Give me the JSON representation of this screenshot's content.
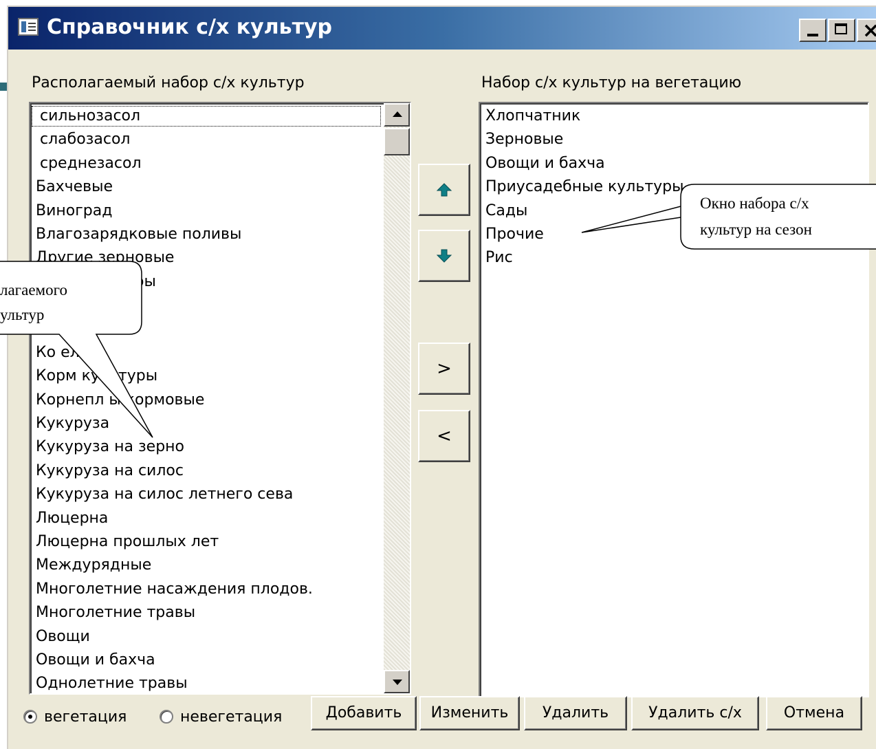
{
  "window": {
    "title": "Справочник с/х культур",
    "close_glyph": "×"
  },
  "left_panel": {
    "label": "Располагаемый набор с/х культур",
    "items": [
      {
        "label": "сильнозасол"
      },
      {
        "label": "слабозасол"
      },
      {
        "label": "среднезасол"
      },
      {
        "label": "Бахчевые"
      },
      {
        "label": "Виноград"
      },
      {
        "label": "Влагозарядковые поливы"
      },
      {
        "label": "Другие зерновые"
      },
      {
        "label": "овые культуры"
      },
      {
        "label": ""
      },
      {
        "label": ""
      },
      {
        "label": "Ко      ель"
      },
      {
        "label": "Корм      культуры"
      },
      {
        "label": "Корнепл     ы кормовые"
      },
      {
        "label": "Кукуруза"
      },
      {
        "label": "Кукуруза на зерно"
      },
      {
        "label": "Кукуруза на силос"
      },
      {
        "label": "Кукуруза на силос летнего сева"
      },
      {
        "label": "Люцерна"
      },
      {
        "label": "Люцерна прошлых лет"
      },
      {
        "label": "Междурядные"
      },
      {
        "label": "Многолетние насаждения плодов."
      },
      {
        "label": "Многолетние травы"
      },
      {
        "label": "Овощи"
      },
      {
        "label": "Овощи и бахча"
      },
      {
        "label": "Однолетние травы"
      }
    ]
  },
  "right_panel": {
    "label": "Набор с/х культур на вегетацию",
    "items": [
      {
        "label": "Хлопчатник"
      },
      {
        "label": "Зерновые"
      },
      {
        "label": "Овощи и бахча"
      },
      {
        "label": "Приусадебные культуры"
      },
      {
        "label": "Сады"
      },
      {
        "label": "Прочие"
      },
      {
        "label": "Рис"
      }
    ]
  },
  "move_buttons": {
    "up_icon": "arrow-up",
    "down_icon": "arrow-down",
    "add_label": ">",
    "remove_label": "<"
  },
  "radios": {
    "option1": "вегетация",
    "option2": "невегетация",
    "selected": "вегетация"
  },
  "buttons": {
    "add": "Добавить",
    "edit": "Изменить",
    "delete": "Удалить",
    "delete_crop": "Удалить с/х",
    "cancel": "Отмена"
  },
  "callouts": {
    "left_line1": "лагаемого",
    "left_line2": "ультур",
    "right_line1": "Окно набора с/х",
    "right_line2": "культур на сезон"
  },
  "colors": {
    "title_gradient_start": "#0a246a",
    "title_gradient_end": "#a6caf0",
    "window_face": "#ece9d8",
    "arrow_teal": "#0f7f86",
    "slide_accent": "#2d6b78"
  }
}
